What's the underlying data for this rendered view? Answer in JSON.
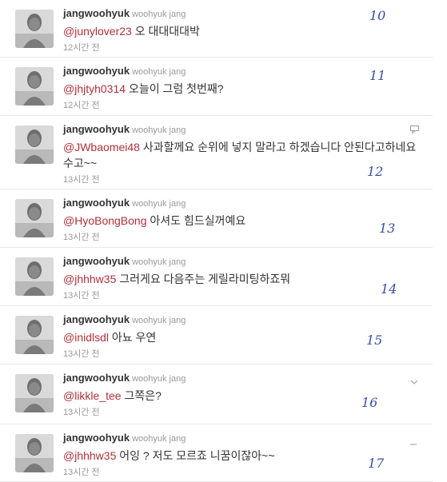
{
  "tweets": [
    {
      "screen_name": "jangwoohyuk",
      "full_name": "woohyuk jang",
      "mention": "@junylover23",
      "text": "오 대대대대박",
      "time": "12시간 전",
      "note": "10"
    },
    {
      "screen_name": "jangwoohyuk",
      "full_name": "woohyuk jang",
      "mention": "@jhjtyh0314",
      "text": "오늘이 그럼 첫번째?",
      "time": "12시간 전",
      "note": "11"
    },
    {
      "screen_name": "jangwoohyuk",
      "full_name": "woohyuk jang",
      "mention": "@JWbaomei48",
      "text": "사과할께요 순위에 넣지 말라고 하겠습니다 안된다고하네요 수고~~",
      "time": "13시간 전",
      "note": "12"
    },
    {
      "screen_name": "jangwoohyuk",
      "full_name": "woohyuk jang",
      "mention": "@HyoBongBong",
      "text": "아셔도 힘드실꺼예요",
      "time": "13시간 전",
      "note": "13"
    },
    {
      "screen_name": "jangwoohyuk",
      "full_name": "woohyuk jang",
      "mention": "@jhhhw35",
      "text": "그러게요 다음주는 게릴라미팅하죠뭐",
      "time": "13시간 전",
      "note": "14"
    },
    {
      "screen_name": "jangwoohyuk",
      "full_name": "woohyuk jang",
      "mention": "@inidlsdl",
      "text": "아뇨 우연",
      "time": "13시간 전",
      "note": "15"
    },
    {
      "screen_name": "jangwoohyuk",
      "full_name": "woohyuk jang",
      "mention": "@likkle_tee",
      "text": "그쪽은?",
      "time": "13시간 전",
      "note": "16"
    },
    {
      "screen_name": "jangwoohyuk",
      "full_name": "woohyuk jang",
      "mention": "@jhhhw35",
      "text": "어잉 ? 저도 모르죠 니꿈이잖아~~",
      "time": "13시간 전",
      "note": "17"
    }
  ],
  "icons": {
    "reply": "reply-icon",
    "avatar": "profile-photo"
  }
}
